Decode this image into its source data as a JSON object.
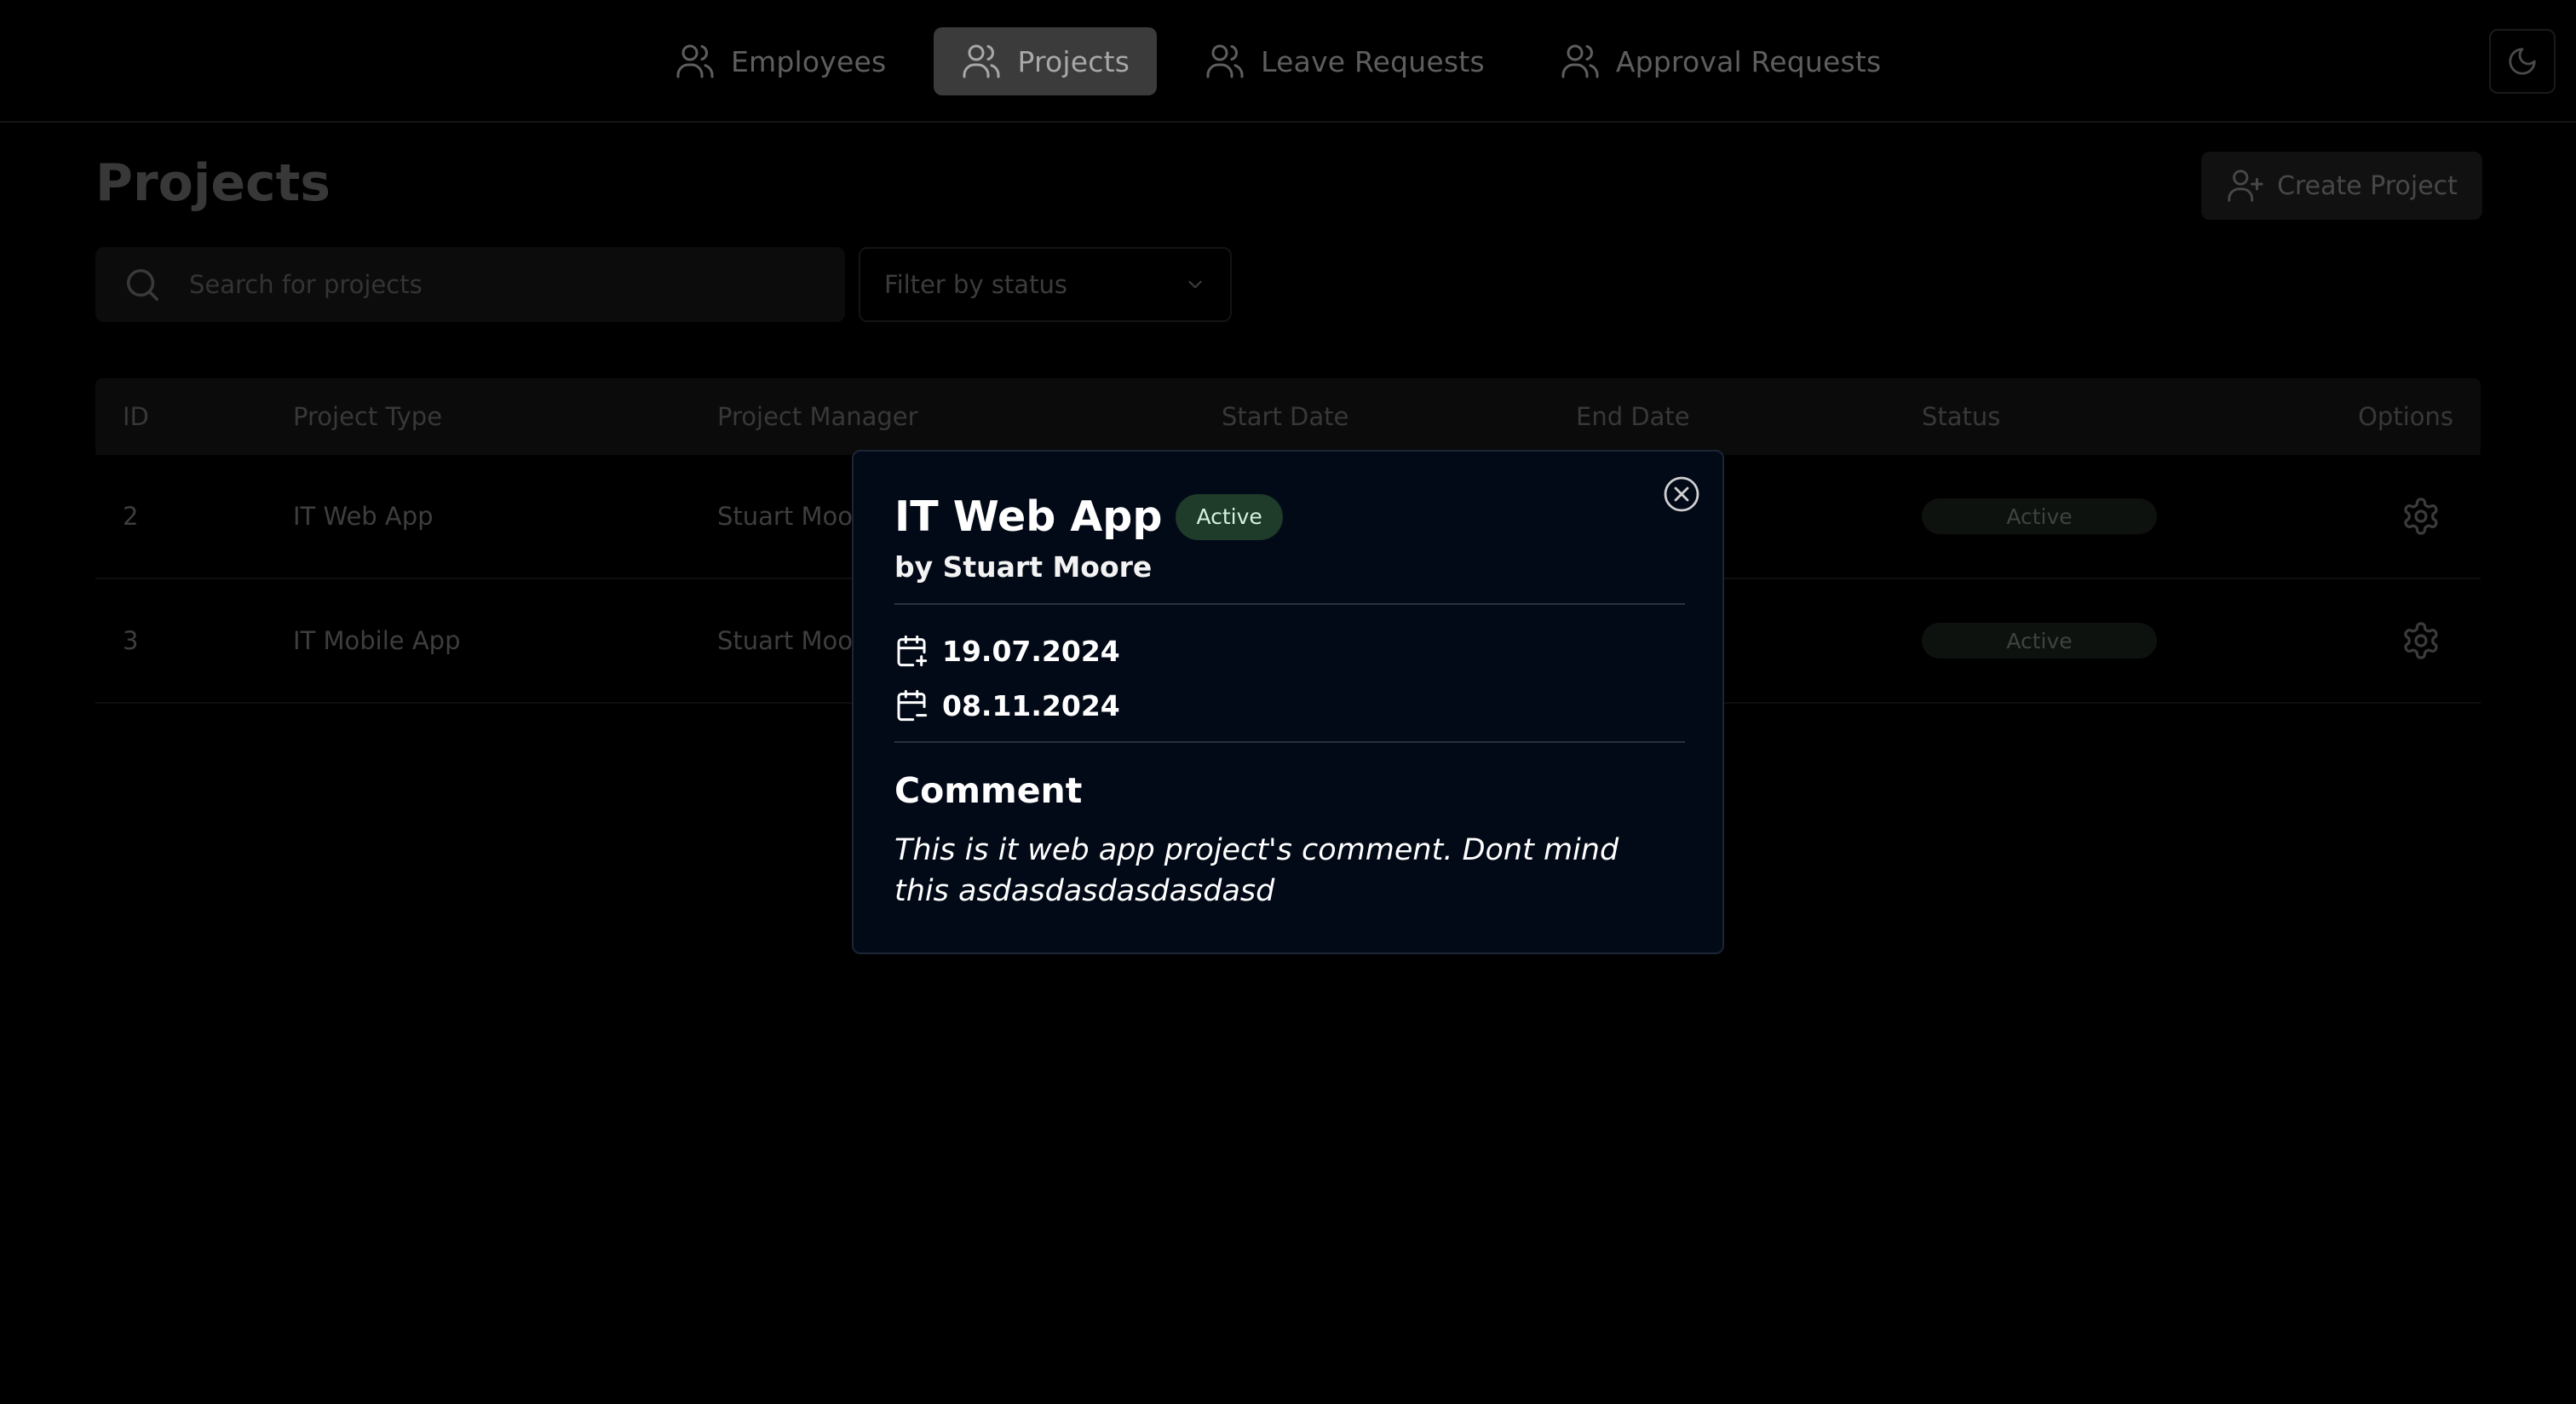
{
  "nav": {
    "items": [
      {
        "label": "Employees",
        "icon": "users-icon",
        "active": false
      },
      {
        "label": "Projects",
        "icon": "users-icon",
        "active": true
      },
      {
        "label": "Leave Requests",
        "icon": "users-icon",
        "active": false
      },
      {
        "label": "Approval Requests",
        "icon": "users-icon",
        "active": false
      }
    ],
    "theme_toggle_icon": "moon-icon"
  },
  "page": {
    "title": "Projects",
    "create_button": "Create Project"
  },
  "filters": {
    "search_placeholder": "Search for projects",
    "status_placeholder": "Filter by status"
  },
  "table": {
    "columns": [
      "ID",
      "Project Type",
      "Project Manager",
      "Start Date",
      "End Date",
      "Status",
      "Options"
    ],
    "rows": [
      {
        "id": "2",
        "type": "IT Web App",
        "manager": "Stuart Moor",
        "status": "Active"
      },
      {
        "id": "3",
        "type": "IT Mobile App",
        "manager": "Stuart Moor",
        "status": "Active"
      }
    ]
  },
  "modal": {
    "title": "IT Web App",
    "status": "Active",
    "manager": "by Stuart Moore",
    "start_date": "19.07.2024",
    "end_date": "08.11.2024",
    "comment_title": "Comment",
    "comment_text": "This is it web app project's comment. Dont mind this asdasdasdasdasdasd"
  },
  "colors": {
    "background": "#000000",
    "modal_background": "#030a17",
    "active_badge": "#1f3b2a"
  }
}
